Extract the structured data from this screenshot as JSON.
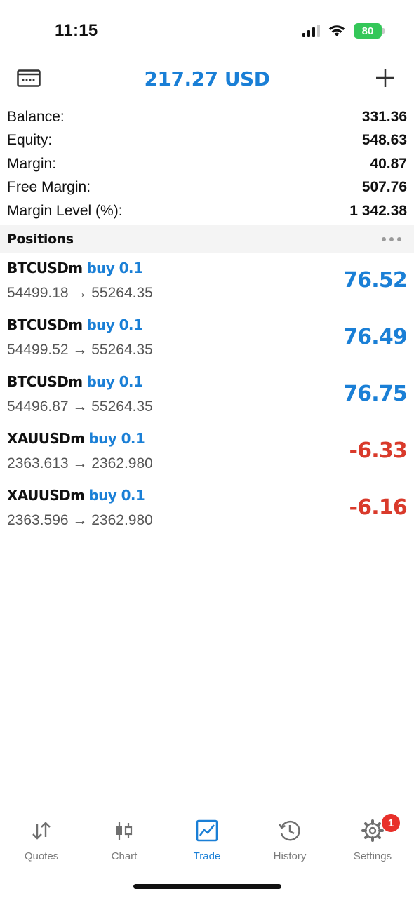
{
  "status": {
    "time": "11:15",
    "battery": "80"
  },
  "header": {
    "title": "217.27 USD",
    "left_icon": "card-icon",
    "right_icon": "plus-icon"
  },
  "summary": [
    {
      "label": "Balance:",
      "value": "331.36"
    },
    {
      "label": "Equity:",
      "value": "548.63"
    },
    {
      "label": "Margin:",
      "value": "40.87"
    },
    {
      "label": "Free Margin:",
      "value": "507.76"
    },
    {
      "label": "Margin Level (%):",
      "value": "1 342.38"
    }
  ],
  "positions_section": {
    "title": "Positions"
  },
  "positions": [
    {
      "symbol": "BTCUSDm",
      "side": "buy 0.1",
      "prices": "54499.18 → 55264.35",
      "profit": "76.52"
    },
    {
      "symbol": "BTCUSDm",
      "side": "buy 0.1",
      "prices": "54499.52 → 55264.35",
      "profit": "76.49"
    },
    {
      "symbol": "BTCUSDm",
      "side": "buy 0.1",
      "prices": "54496.87 → 55264.35",
      "profit": "76.75"
    },
    {
      "symbol": "XAUUSDm",
      "side": "buy 0.1",
      "prices": "2363.613 → 2362.980",
      "profit": "-6.33"
    },
    {
      "symbol": "XAUUSDm",
      "side": "buy 0.1",
      "prices": "2363.596 → 2362.980",
      "profit": "-6.16"
    }
  ],
  "colors": {
    "accent": "#1a7fd6",
    "negative": "#d93a2b",
    "badge": "#e8302a"
  },
  "tabs": [
    {
      "label": "Quotes",
      "icon": "quotes-arrows-icon"
    },
    {
      "label": "Chart",
      "icon": "candlestick-icon"
    },
    {
      "label": "Trade",
      "icon": "trade-chart-icon",
      "active": true
    },
    {
      "label": "History",
      "icon": "history-clock-icon"
    },
    {
      "label": "Settings",
      "icon": "gear-icon",
      "badge": "1"
    }
  ]
}
